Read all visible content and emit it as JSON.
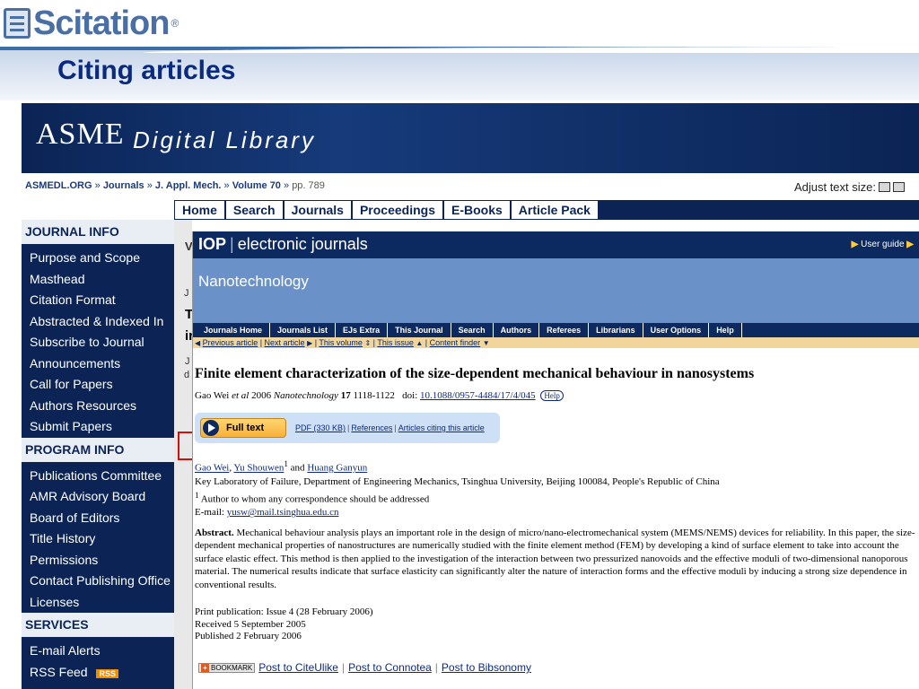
{
  "slide": {
    "logo": "Scitation",
    "logo_mark": "®",
    "title": "Citing articles"
  },
  "asme": {
    "logo": "ASME",
    "logo_sub": "Digital Library",
    "breadcrumbs": [
      "ASMEDL.ORG",
      "Journals",
      "J. Appl. Mech.",
      "Volume 70"
    ],
    "breadcrumb_sep": "»",
    "pages": "pp. 789",
    "adjust_text": "Adjust text size:",
    "nav": [
      "Home",
      "Search",
      "Journals",
      "Proceedings",
      "E-Books",
      "Article Pack"
    ],
    "sidebar": {
      "journal_info": {
        "header": "JOURNAL INFO",
        "items": [
          "Purpose and Scope",
          "Masthead",
          "Citation Format",
          "Abstracted & Indexed In",
          "Subscribe to Journal",
          "Announcements",
          "Call for Papers",
          "Authors Resources",
          "Submit Papers"
        ]
      },
      "program_info": {
        "header": "PROGRAM INFO",
        "items": [
          "Publications Committee",
          "AMR Advisory Board",
          "Board of Editors",
          "Title History",
          "Permissions",
          "Contact Publishing Office",
          "Licenses"
        ]
      },
      "services": {
        "header": "SERVICES",
        "items": [
          "E-mail Alerts",
          "RSS Feed"
        ],
        "rss_badge": "RSS"
      }
    },
    "stub_letters": [
      "V",
      "J",
      "T",
      "ir",
      "J",
      "d"
    ]
  },
  "iop": {
    "brand": "IOP",
    "brand_sub": "electronic journals",
    "user_guide": "User guide",
    "journal": "Nanotechnology",
    "menu": [
      "Journals Home",
      "Journals List",
      "EJs Extra",
      "This Journal",
      "Search",
      "Authors",
      "Referees",
      "Librarians",
      "User Options",
      "Help"
    ],
    "links": {
      "previous": "Previous article",
      "next": "Next article",
      "volume": "This volume",
      "issue": "This issue",
      "finder": "Content finder"
    },
    "article": {
      "title": "Finite element characterization of the size-dependent mechanical behaviour in nanosystems",
      "cite_authors": "Gao Wei",
      "cite_etal": "et al",
      "cite_year": "2006",
      "cite_journal": "Nanotechnology",
      "cite_volume": "17",
      "cite_pages": "1118-1122",
      "doi_label": "doi:",
      "doi": "10.1088/0957-4484/17/4/045",
      "help": "Help",
      "full_text": "Full text",
      "pdf": "PDF (330 KB)",
      "references": "References",
      "citing": "Articles citing this article",
      "author1": "Gao Wei",
      "author2": "Yu Shouwen",
      "author2_sup": "1",
      "and": "and",
      "author3": "Huang Ganyun",
      "affiliation": "Key Laboratory of Failure, Department of Engineering Mechanics, Tsinghua University, Beijing 100084, People's Republic of China",
      "corr_sup": "1",
      "correspondence": "Author to whom any correspondence should be addressed",
      "email_label": "E-mail:",
      "email": "yusw@mail.tsinghua.edu.cn",
      "abstract_label": "Abstract.",
      "abstract": "Mechanical behaviour analysis plays an important role in the design of micro/nano-electromechanical system (MEMS/NEMS) devices for reliability. In this paper, the size-dependent mechanical properties of nanostructures are numerically studied with the finite element method (FEM) by developing a kind of surface element to take into account the surface elastic effect. This method is then applied to the investigation of the interaction between two pressurized nanovoids and the effective moduli of two-dimensional nanoporous material. The numerical results indicate that surface elasticity can significantly alter the nature of interaction forms and the effective moduli by inducing a strong size dependence in conventional results.",
      "print_pub_label": "Print publication: Issue",
      "print_issue": "4",
      "print_date": "(28 February 2006)",
      "received": "Received 5 September 2005",
      "published": "Published 2 February 2006"
    },
    "social": {
      "bookmark": "BOOKMARK",
      "citeulike": "Post to CiteUlike",
      "connotea": "Post to Connotea",
      "bibsonomy": "Post to Bibsonomy"
    }
  }
}
